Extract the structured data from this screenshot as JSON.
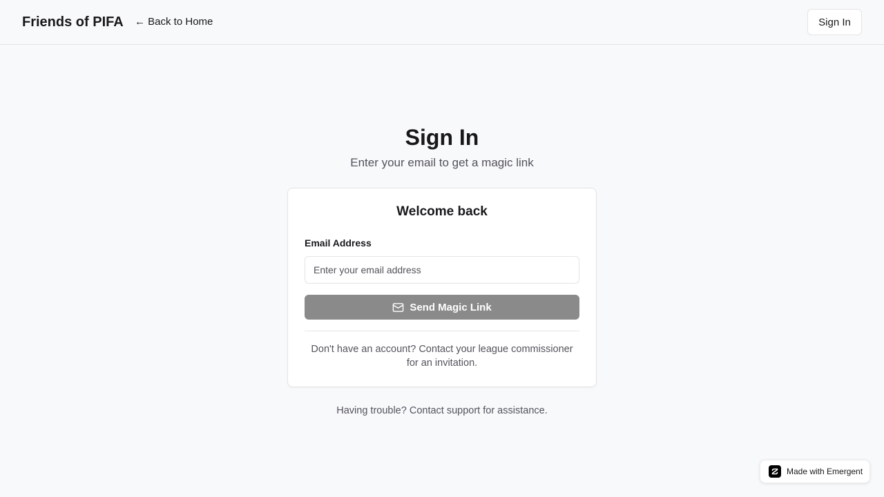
{
  "header": {
    "brand": "Friends of PIFA",
    "back_link": "← Back to Home",
    "signin_label": "Sign In"
  },
  "main": {
    "title": "Sign In",
    "subtitle": "Enter your email to get a magic link"
  },
  "card": {
    "title": "Welcome back",
    "email_label": "Email Address",
    "email_placeholder": "Enter your email address",
    "email_value": "",
    "send_label": "Send Magic Link",
    "send_icon": "mail-icon",
    "note": "Don't have an account? Contact your league commissioner for an invitation."
  },
  "footer": {
    "help_text": "Having trouble? Contact support for assistance."
  },
  "badge": {
    "label": "Made with Emergent",
    "icon": "emergent-logo-icon"
  },
  "colors": {
    "background": "#f8f9fb",
    "border": "#e4e4e7",
    "text": "#18181b",
    "muted_text": "#52525b",
    "button_disabled": "#8a8a8a"
  }
}
